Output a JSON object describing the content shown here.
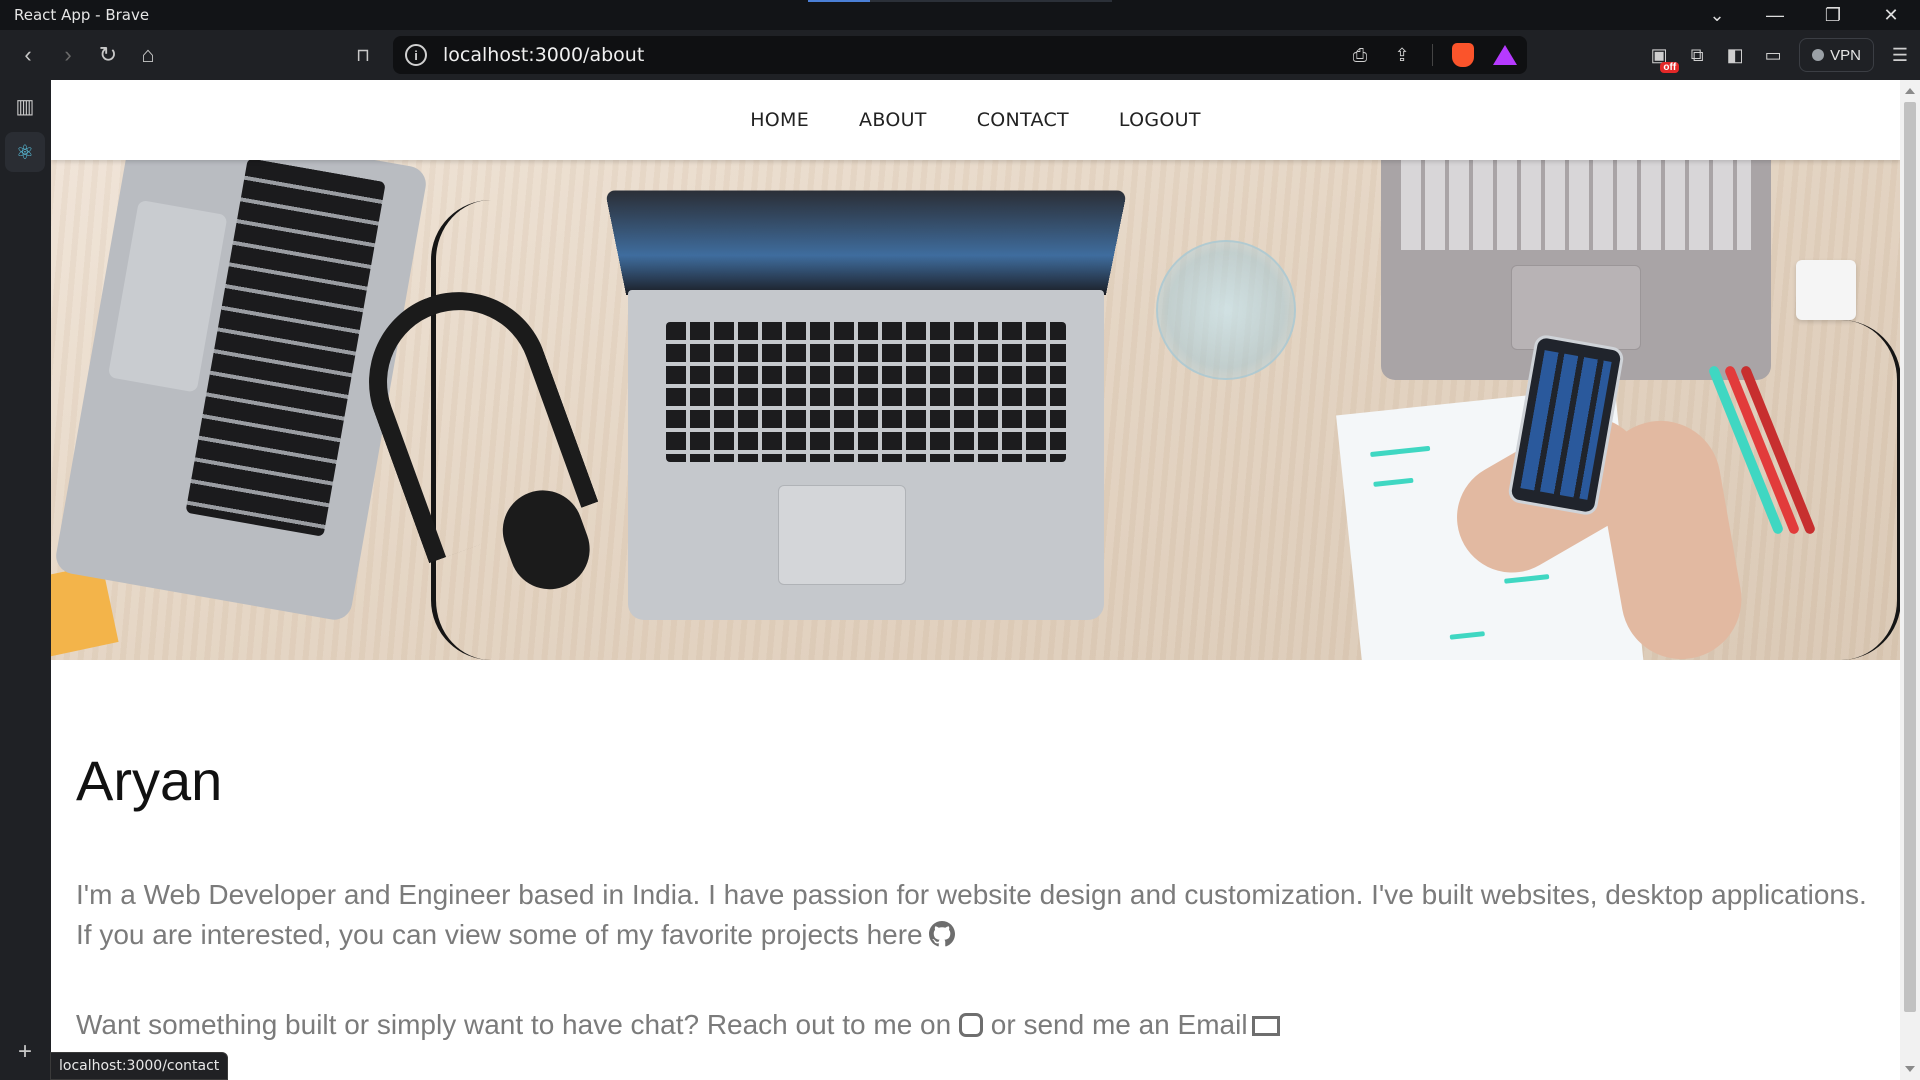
{
  "window": {
    "title": "React App - Brave",
    "controls": [
      "chevron-down",
      "minimize",
      "restore",
      "close"
    ]
  },
  "toolbar": {
    "url": "localhost:3000/about",
    "vpn_label": "VPN",
    "shields_badge": "off"
  },
  "nav": {
    "items": [
      "HOME",
      "ABOUT",
      "CONTACT",
      "LOGOUT"
    ]
  },
  "page": {
    "name": "Aryan",
    "bio_line1": "I'm a Web Developer and Engineer based in India. I have passion for website design and customization. I've built websites, desktop applications.",
    "bio_line2": "If you are interested, you can view some of my favorite projects here",
    "bio_contact": "Want something built or simply want to have chat? Reach out to me on",
    "bio_contact_2": "or send me an Email"
  },
  "status_bar": {
    "hover_url": "localhost:3000/contact"
  }
}
